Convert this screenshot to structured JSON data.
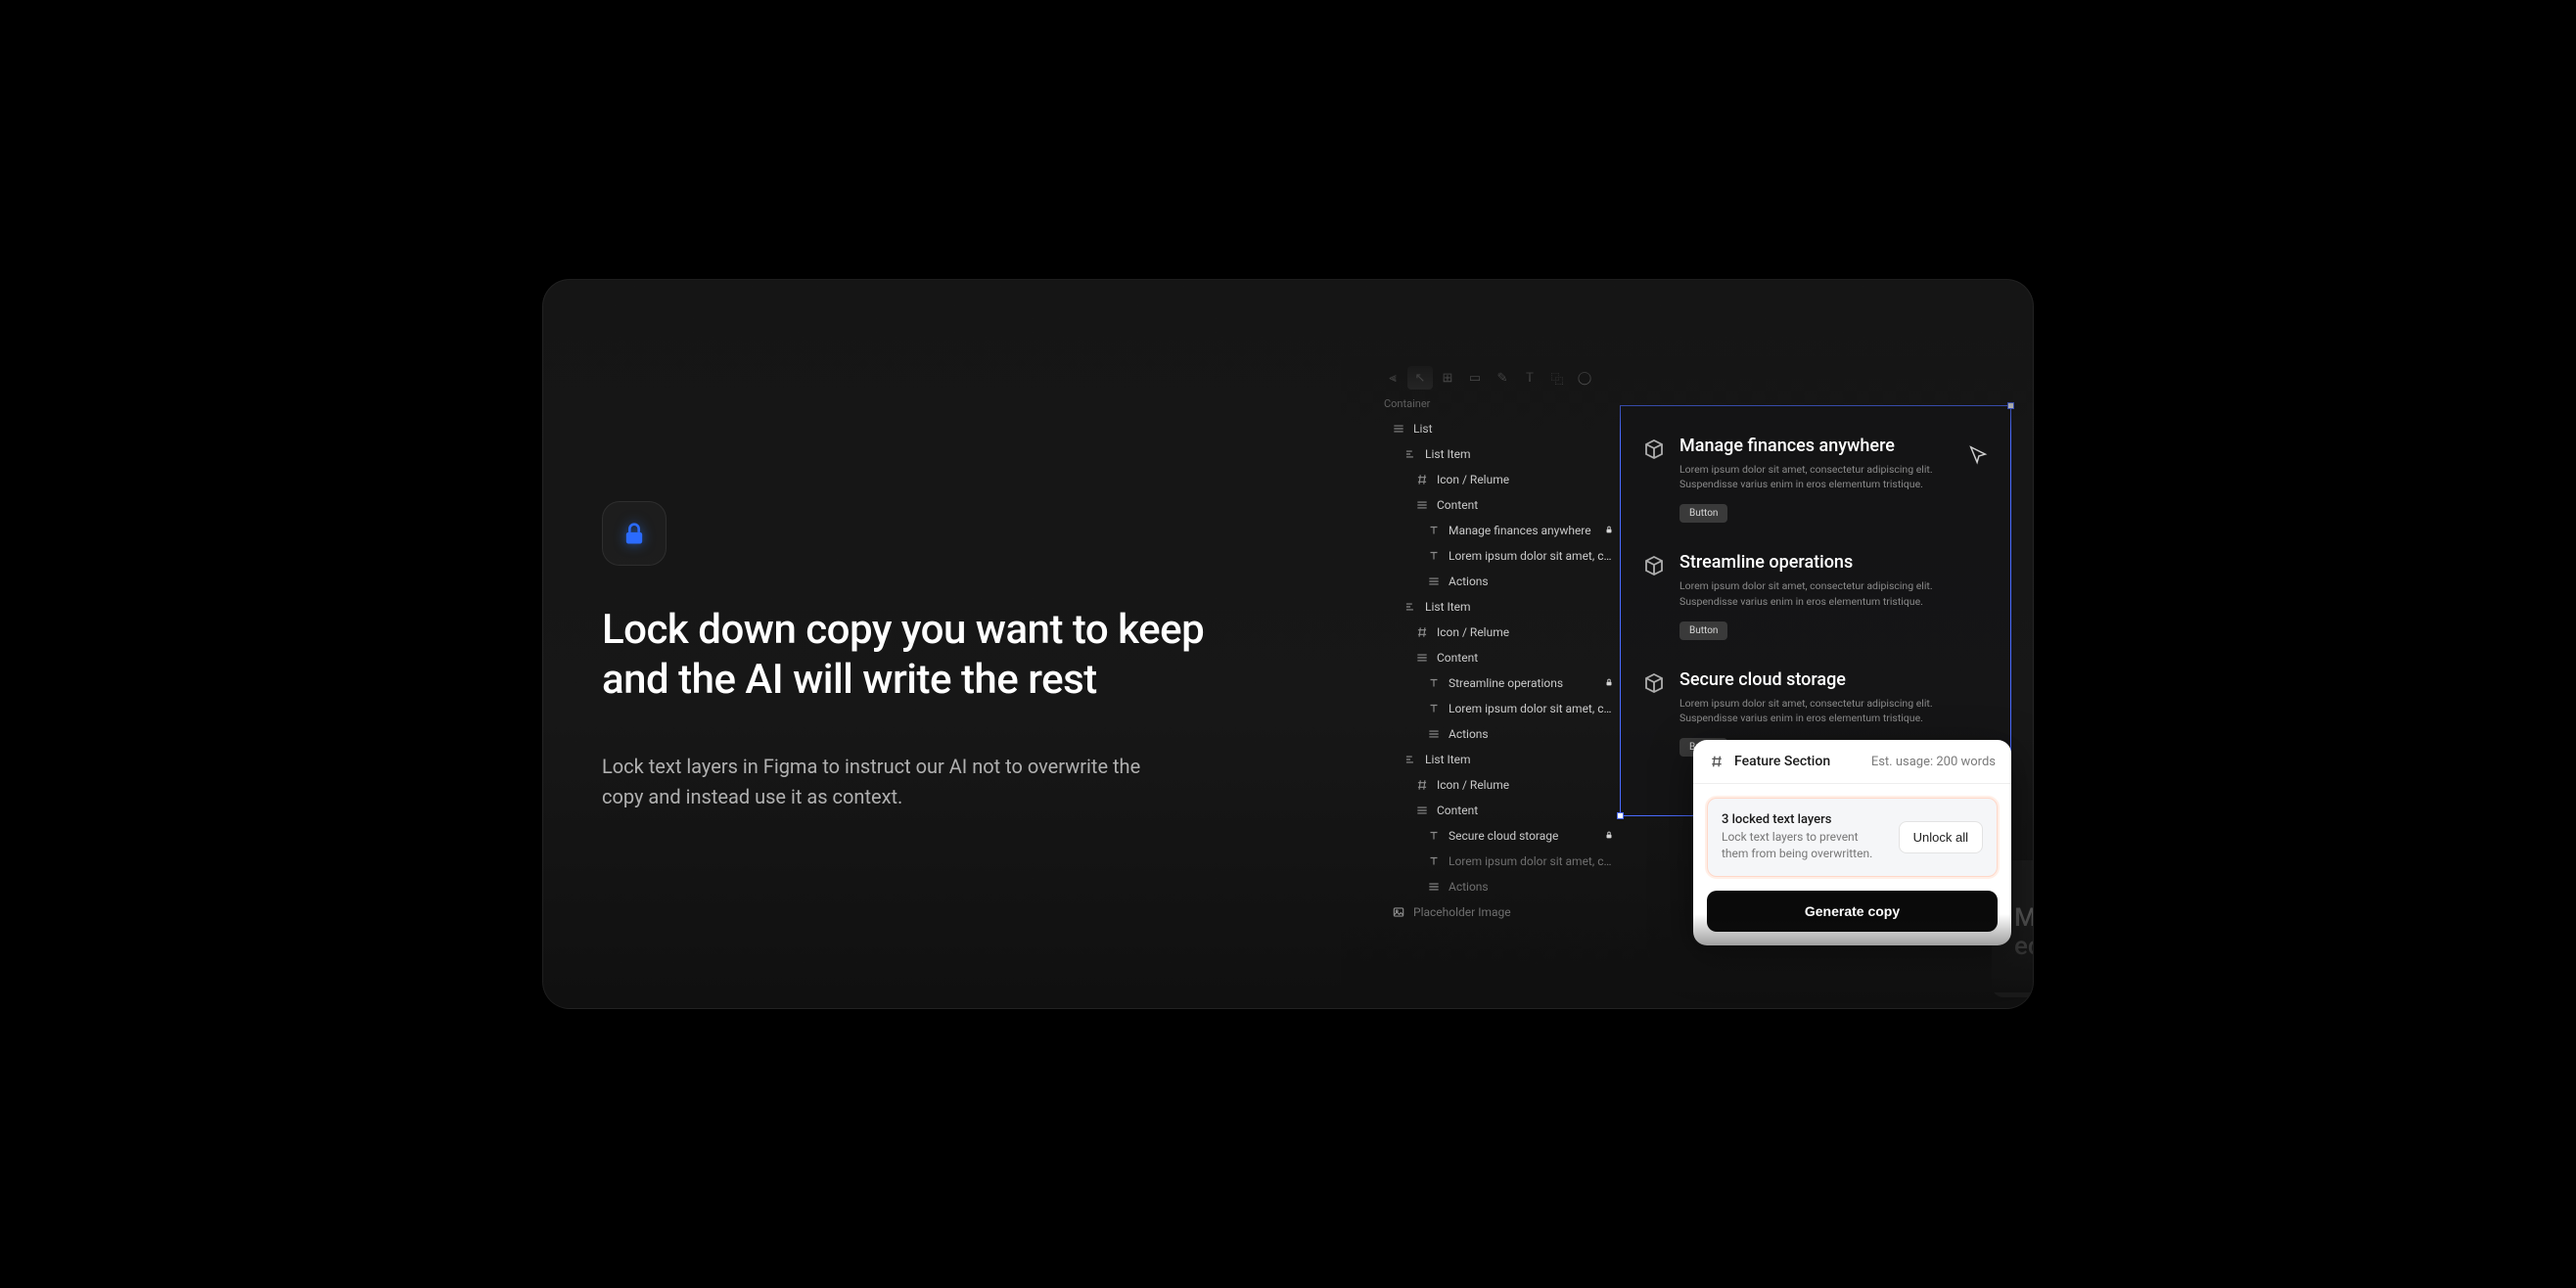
{
  "hero": {
    "headline": "Lock down copy you want to keep and the AI will write the rest",
    "subhead": "Lock text layers in Figma to instruct our AI not to overwrite the copy and instead use it as context."
  },
  "layers": {
    "root": "Container",
    "items": [
      {
        "depth": 1,
        "icon": "bars",
        "label": "List"
      },
      {
        "depth": 2,
        "icon": "align",
        "label": "List Item"
      },
      {
        "depth": 3,
        "icon": "hash",
        "label": "Icon / Relume"
      },
      {
        "depth": 3,
        "icon": "bars",
        "label": "Content"
      },
      {
        "depth": 4,
        "icon": "text",
        "label": "Manage finances anywhere",
        "locked": true
      },
      {
        "depth": 4,
        "icon": "text",
        "label": "Lorem ipsum dolor sit amet, conse…"
      },
      {
        "depth": 4,
        "icon": "bars",
        "label": "Actions"
      },
      {
        "depth": 2,
        "icon": "align",
        "label": "List Item"
      },
      {
        "depth": 3,
        "icon": "hash",
        "label": "Icon / Relume"
      },
      {
        "depth": 3,
        "icon": "bars",
        "label": "Content"
      },
      {
        "depth": 4,
        "icon": "text",
        "label": "Streamline operations",
        "locked": true
      },
      {
        "depth": 4,
        "icon": "text",
        "label": "Lorem ipsum dolor sit amet, conse…"
      },
      {
        "depth": 4,
        "icon": "bars",
        "label": "Actions"
      },
      {
        "depth": 2,
        "icon": "align",
        "label": "List Item"
      },
      {
        "depth": 3,
        "icon": "hash",
        "label": "Icon / Relume"
      },
      {
        "depth": 3,
        "icon": "bars",
        "label": "Content"
      },
      {
        "depth": 4,
        "icon": "text",
        "label": "Secure cloud storage",
        "locked": true
      },
      {
        "depth": 4,
        "icon": "text",
        "label": "Lorem ipsum dolor sit amet, conse…",
        "muted": true
      },
      {
        "depth": 4,
        "icon": "bars",
        "label": "Actions",
        "muted": true
      },
      {
        "depth": 1,
        "icon": "image",
        "label": "Placeholder Image",
        "muted": true
      }
    ]
  },
  "canvas": {
    "features": [
      {
        "title": "Manage finances anywhere",
        "desc": "Lorem ipsum dolor sit amet, consectetur adipiscing elit. Suspendisse varius enim in eros elementum tristique.",
        "button": "Button"
      },
      {
        "title": "Streamline operations",
        "desc": "Lorem ipsum dolor sit amet, consectetur adipiscing elit. Suspendisse varius enim in eros elementum tristique.",
        "button": "Button"
      },
      {
        "title": "Secure cloud storage",
        "desc": "Lorem ipsum dolor sit amet, consectetur adipiscing elit. Suspendisse varius enim in eros elementum tristique.",
        "button": "Button"
      }
    ]
  },
  "popover": {
    "title": "Feature Section",
    "estimate": "Est. usage: 200 words",
    "locked_heading": "3 locked text layers",
    "locked_desc": "Lock text layers to prevent them from being overwritten.",
    "unlock": "Unlock all",
    "generate": "Generate copy"
  },
  "ghost": "Medi\nect"
}
